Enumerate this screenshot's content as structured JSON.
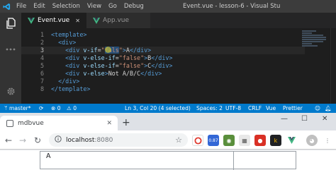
{
  "vscode": {
    "menu": [
      "File",
      "Edit",
      "Selection",
      "View",
      "Go",
      "Debug"
    ],
    "window_title": "Event.vue - lesson-6 - Visual Stu",
    "tabs": [
      {
        "label": "Event.vue",
        "active": true
      },
      {
        "label": "App.vue",
        "active": false
      }
    ],
    "code_lines": [
      {
        "num": "1",
        "parts": [
          {
            "t": "tag",
            "v": "<template>"
          }
        ]
      },
      {
        "num": "2",
        "parts": [
          {
            "t": "txt",
            "v": "  "
          },
          {
            "t": "tag",
            "v": "<div>"
          }
        ]
      },
      {
        "num": "3",
        "parts": [
          {
            "t": "txt",
            "v": "    "
          },
          {
            "t": "tag",
            "v": "<div "
          },
          {
            "t": "attr",
            "v": "v-if"
          },
          {
            "t": "txt",
            "v": "="
          },
          {
            "t": "str",
            "v": "\""
          },
          {
            "t": "sel",
            "v": "fals"
          },
          {
            "t": "str",
            "v": "\""
          },
          {
            "t": "tag",
            "v": ">"
          },
          {
            "t": "txt",
            "v": "A"
          },
          {
            "t": "tag",
            "v": "</div>"
          }
        ]
      },
      {
        "num": "4",
        "parts": [
          {
            "t": "txt",
            "v": "    "
          },
          {
            "t": "tag",
            "v": "<div "
          },
          {
            "t": "attr",
            "v": "v-else-if"
          },
          {
            "t": "txt",
            "v": "="
          },
          {
            "t": "str",
            "v": "\"false\""
          },
          {
            "t": "tag",
            "v": ">"
          },
          {
            "t": "txt",
            "v": "B"
          },
          {
            "t": "tag",
            "v": "</div>"
          }
        ]
      },
      {
        "num": "5",
        "parts": [
          {
            "t": "txt",
            "v": "    "
          },
          {
            "t": "tag",
            "v": "<div "
          },
          {
            "t": "attr",
            "v": "v-else-if"
          },
          {
            "t": "txt",
            "v": "="
          },
          {
            "t": "str",
            "v": "\"false\""
          },
          {
            "t": "tag",
            "v": ">"
          },
          {
            "t": "txt",
            "v": "C"
          },
          {
            "t": "tag",
            "v": "</div>"
          }
        ]
      },
      {
        "num": "6",
        "parts": [
          {
            "t": "txt",
            "v": "    "
          },
          {
            "t": "tag",
            "v": "<div "
          },
          {
            "t": "attr",
            "v": "v-else"
          },
          {
            "t": "tag",
            "v": ">"
          },
          {
            "t": "txt",
            "v": "Not A/B/C"
          },
          {
            "t": "tag",
            "v": "</div>"
          }
        ]
      },
      {
        "num": "7",
        "parts": [
          {
            "t": "txt",
            "v": "  "
          },
          {
            "t": "tag",
            "v": "</div>"
          }
        ]
      },
      {
        "num": "8",
        "parts": [
          {
            "t": "tag",
            "v": "</template>"
          }
        ]
      }
    ],
    "status": {
      "branch": "master*",
      "cursor_pos": "Ln 3, Col 20 (4 selected)",
      "spaces": "Spaces: 2",
      "encoding": "UTF-8",
      "eol": "CRLF",
      "language": "Vue",
      "formatter": "Prettier"
    },
    "colors": {
      "statusbar": "#007acc",
      "editor_bg": "#1e1e1e",
      "vue_green": "#41b883"
    }
  },
  "browser": {
    "tab_title": "mdbvue",
    "url_host": "localhost",
    "url_port": ":8080",
    "ext_badge": "0.87",
    "page_text": "A"
  }
}
